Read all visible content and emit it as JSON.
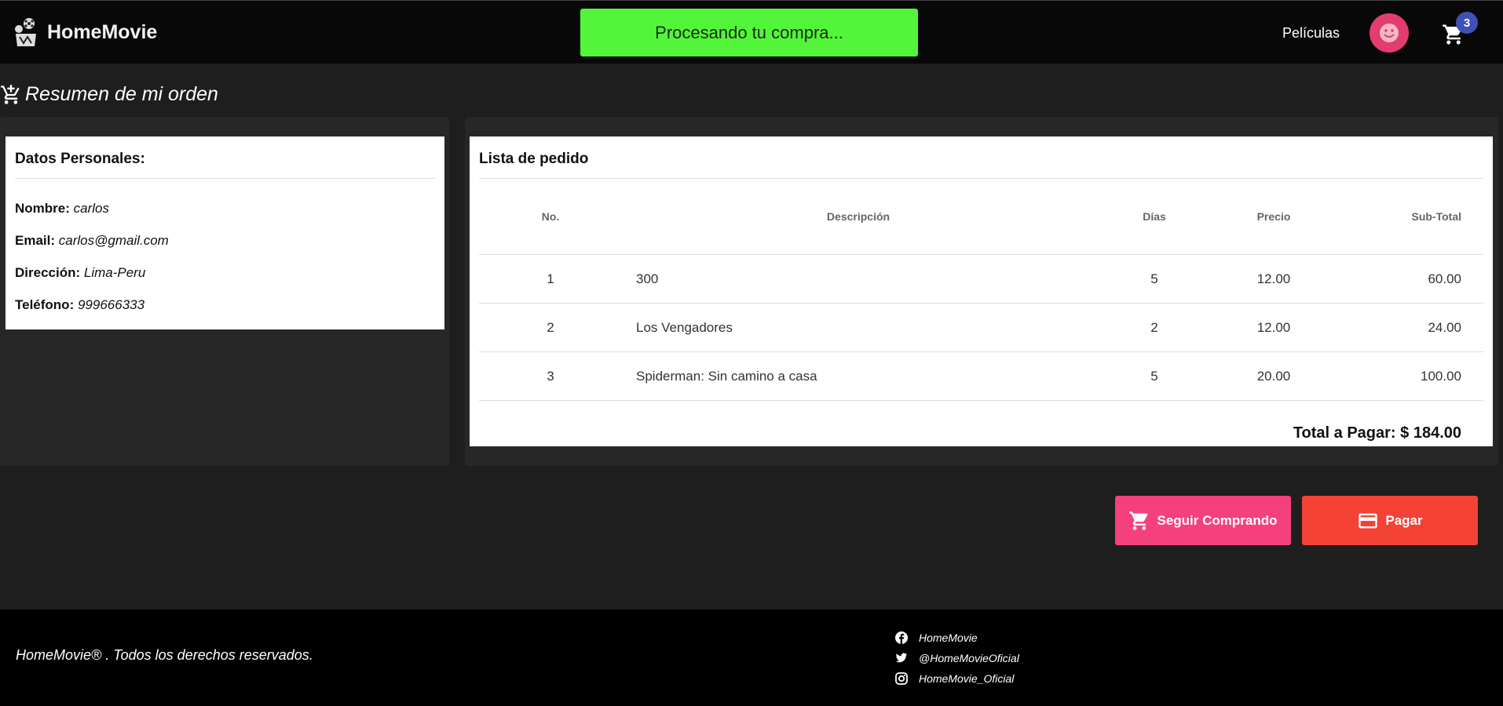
{
  "header": {
    "brand": "HomeMovie",
    "toast": "Procesando tu compra...",
    "nav_peliculas": "Películas",
    "cart_count": "3",
    "icons": {
      "logo": "film-reel-icon",
      "avatar": "smiley-icon",
      "cart": "cart-icon"
    },
    "colors": {
      "toast": "#53f53a",
      "avatar": "#e23d6e",
      "badge": "#3f51b5"
    }
  },
  "page": {
    "title": "Resumen de mi orden",
    "title_icon": "cart-add-icon"
  },
  "personal": {
    "heading": "Datos Personales:",
    "fields": [
      {
        "label": "Nombre:",
        "value": "carlos"
      },
      {
        "label": "Email:",
        "value": "carlos@gmail.com"
      },
      {
        "label": "Dirección:",
        "value": "Lima-Peru"
      },
      {
        "label": "Teléfono:",
        "value": "999666333"
      }
    ]
  },
  "orders": {
    "heading": "Lista de pedido",
    "columns": [
      "No.",
      "Descripción",
      "Días",
      "Precio",
      "Sub-Total"
    ],
    "rows": [
      {
        "no": "1",
        "desc": "300",
        "dias": "5",
        "precio": "12.00",
        "subtotal": "60.00"
      },
      {
        "no": "2",
        "desc": "Los Vengadores",
        "dias": "2",
        "precio": "12.00",
        "subtotal": "24.00"
      },
      {
        "no": "3",
        "desc": "Spiderman: Sin camino a casa",
        "dias": "5",
        "precio": "20.00",
        "subtotal": "100.00"
      }
    ],
    "total_label": "Total a Pagar: $ 184.00"
  },
  "actions": {
    "continue": "Seguir Comprando",
    "pay": "Pagar",
    "colors": {
      "continue": "#f5407e",
      "pay": "#f44336"
    },
    "icons": {
      "continue": "cart-icon",
      "pay": "credit-card-icon"
    }
  },
  "footer": {
    "copyright": "HomeMovie® . Todos los derechos reservados.",
    "social": [
      {
        "icon": "facebook-icon",
        "label": "HomeMovie"
      },
      {
        "icon": "twitter-icon",
        "label": "@HomeMovieOficial"
      },
      {
        "icon": "instagram-icon",
        "label": "HomeMovie_Oficial"
      }
    ]
  }
}
